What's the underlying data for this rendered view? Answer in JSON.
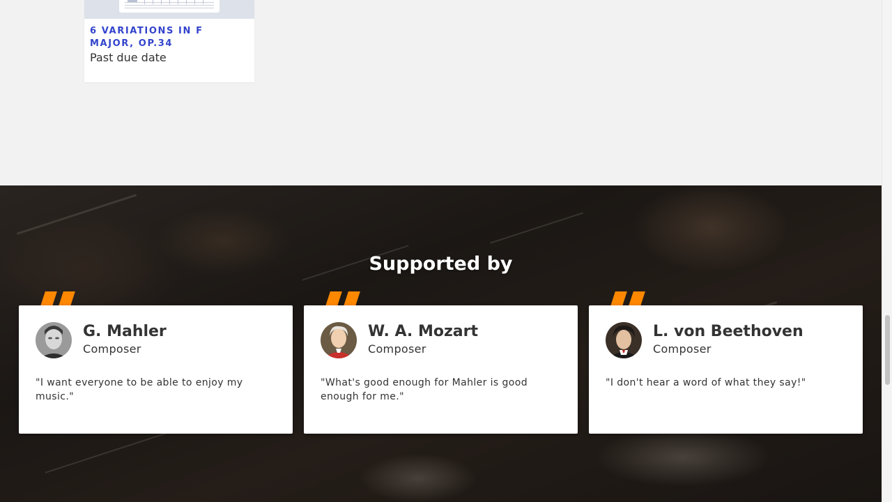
{
  "piece": {
    "title": "6 VARIATIONS IN F MAJOR, OP.34",
    "status": "Past due date"
  },
  "supporters": {
    "heading": "Supported by",
    "accent_color": "#ff8800",
    "cards": [
      {
        "name": "G. Mahler",
        "role": "Composer",
        "quote": "\"I want everyone to be able to enjoy my music.\"",
        "avatar_icon": "mahler-portrait"
      },
      {
        "name": "W. A. Mozart",
        "role": "Composer",
        "quote": "\"What's good enough for Mahler is good enough for me.\"",
        "avatar_icon": "mozart-portrait"
      },
      {
        "name": "L. von Beethoven",
        "role": "Composer",
        "quote": "\"I don't hear a word of what they say!\"",
        "avatar_icon": "beethoven-portrait"
      }
    ]
  }
}
